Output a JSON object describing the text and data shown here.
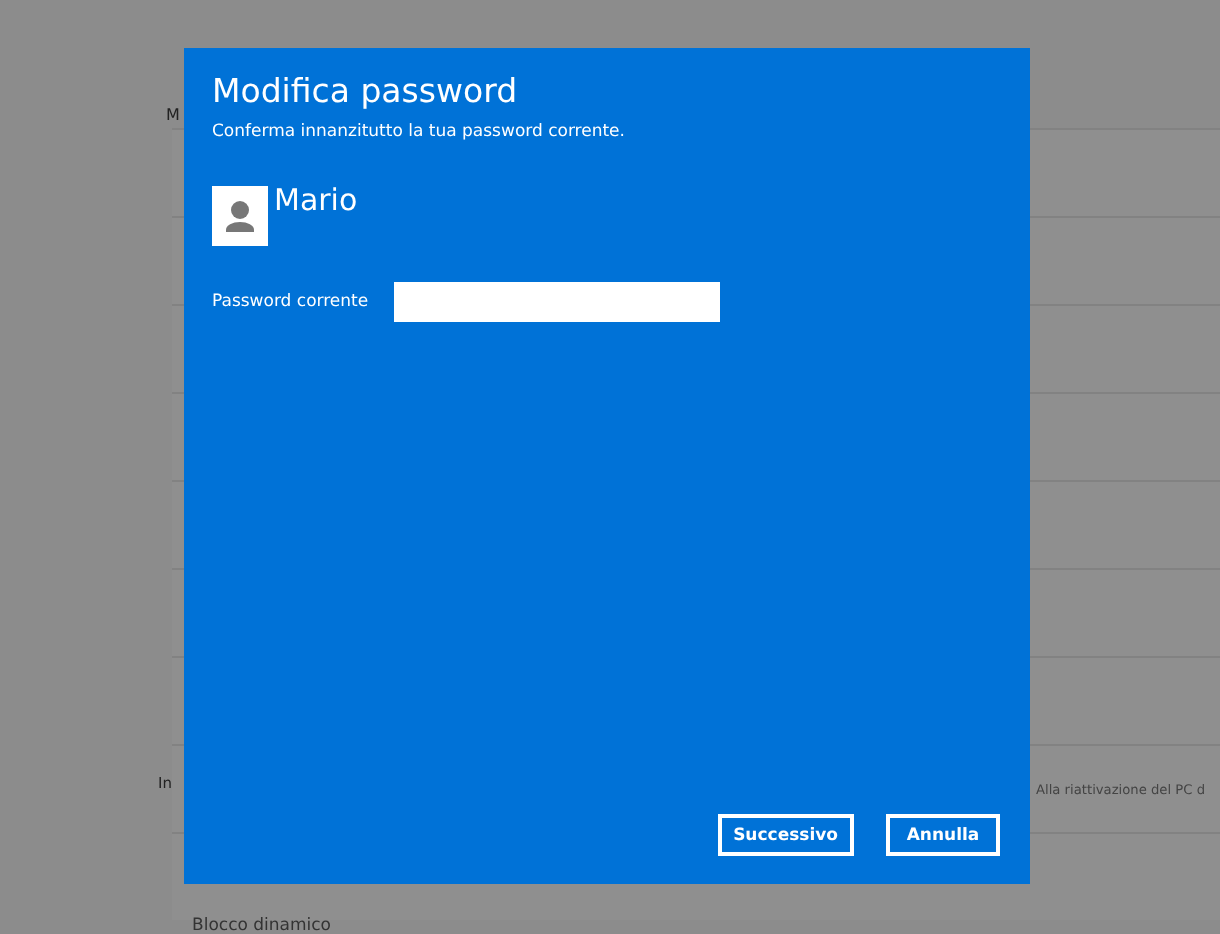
{
  "background": {
    "section_letter": "M",
    "section_fragment": "In",
    "rows_right": [
      "Alla riattivazione del PC d"
    ],
    "bottom_label": "Blocco dinamico"
  },
  "dialog": {
    "title": "Modifica password",
    "subtitle": "Conferma innanzitutto la tua password corrente.",
    "user": {
      "name": "Mario"
    },
    "field": {
      "label": "Password corrente"
    },
    "buttons": [
      {
        "label": "Successivo",
        "kind": "primary"
      },
      {
        "label": "Annulla",
        "kind": "cancel"
      }
    ]
  }
}
